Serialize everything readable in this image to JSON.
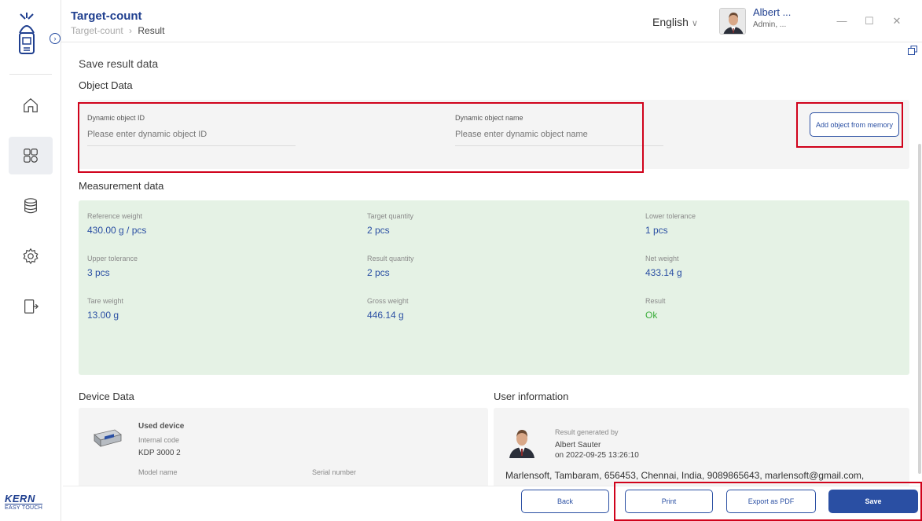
{
  "header": {
    "title": "Target-count",
    "breadcrumb": [
      "Target-count",
      "Result"
    ],
    "language": "English",
    "user_name": "Albert ...",
    "user_role": "Admin, ..."
  },
  "kern": {
    "brand": "KERN",
    "sub": "EASY TOUCH"
  },
  "page": {
    "heading": "Save result data",
    "object_data_title": "Object Data",
    "object_id_label": "Dynamic object ID",
    "object_id_placeholder": "Please enter dynamic object ID",
    "object_name_label": "Dynamic object name",
    "object_name_placeholder": "Please enter dynamic object name",
    "add_object_button": "Add object from memory",
    "measurement_title": "Measurement data",
    "measurements": [
      {
        "label": "Reference weight",
        "value": "430.00 g / pcs"
      },
      {
        "label": "Target quantity",
        "value": "2 pcs"
      },
      {
        "label": "Lower tolerance",
        "value": "1 pcs"
      },
      {
        "label": "Upper tolerance",
        "value": "3 pcs"
      },
      {
        "label": "Result quantity",
        "value": "2 pcs"
      },
      {
        "label": "Net weight",
        "value": "433.14 g"
      },
      {
        "label": "Tare weight",
        "value": "13.00 g"
      },
      {
        "label": "Gross weight",
        "value": "446.14 g"
      },
      {
        "label": "Result",
        "value": "Ok"
      }
    ],
    "device_title": "Device Data",
    "device": {
      "used_device_label": "Used device",
      "internal_code_label": "Internal code",
      "internal_code": "KDP 3000 2",
      "model_name_label": "Model name",
      "serial_number_label": "Serial number"
    },
    "user_info_title": "User information",
    "user_info": {
      "generated_by_label": "Result generated by",
      "generated_by": "Albert Sauter",
      "generated_on": "on 2022-09-25 13:26:10",
      "address": "Marlensoft, Tambaram, 656453, Chennai, India, 9089865643, marlensoft@gmail.com,"
    }
  },
  "footer": {
    "back": "Back",
    "print": "Print",
    "export": "Export as PDF",
    "save": "Save"
  },
  "colors": {
    "accent": "#2a4fa3",
    "measurement_bg": "#e5f2e5",
    "ok": "#3cae3c",
    "highlight": "#d0021b"
  },
  "icons": [
    "expand-icon",
    "home-icon",
    "apps-icon",
    "database-icon",
    "settings-icon",
    "logout-icon",
    "chevron-down-icon",
    "minimize-icon",
    "maximize-icon",
    "close-icon",
    "restore-icon"
  ]
}
